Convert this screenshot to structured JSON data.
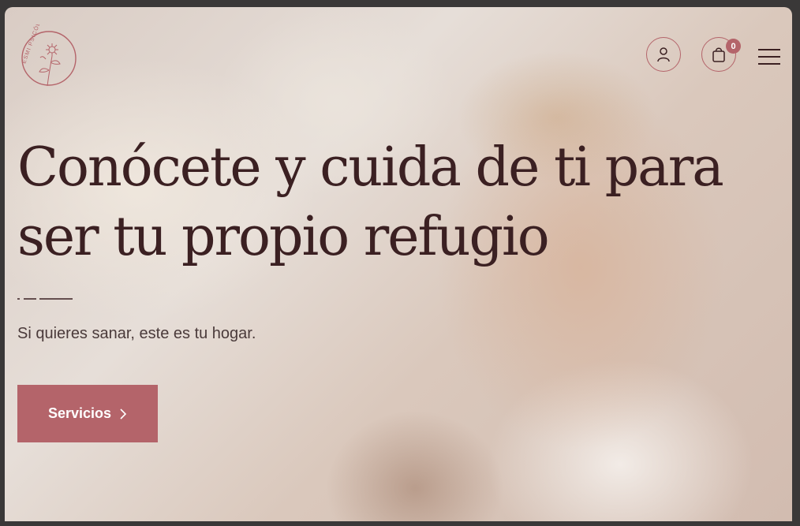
{
  "brand": {
    "logo_text": "ESMI PSICÓLOGA",
    "accent_color": "#b4646a",
    "text_color": "#3b2022"
  },
  "header": {
    "account_icon": "user-icon",
    "cart_icon": "shopping-bag-icon",
    "cart_count": "0",
    "menu_icon": "hamburger-menu-icon"
  },
  "hero": {
    "headline_line1": "Conócete y cuida de ti para",
    "headline_line2": "ser tu propio refugio",
    "subtitle": "Si quieres sanar, este es tu hogar.",
    "cta_label": "Servicios",
    "cta_icon": "chevron-right-icon"
  }
}
